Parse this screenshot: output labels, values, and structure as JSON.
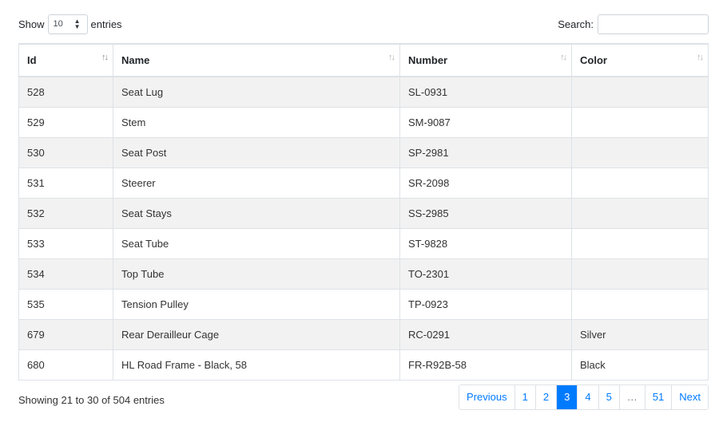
{
  "length_control": {
    "prefix": "Show",
    "selected": "10",
    "suffix": "entries"
  },
  "search": {
    "label": "Search:",
    "value": "",
    "placeholder": ""
  },
  "table": {
    "columns": [
      {
        "label": "Id",
        "sorted": "asc"
      },
      {
        "label": "Name",
        "sorted": "none"
      },
      {
        "label": "Number",
        "sorted": "none"
      },
      {
        "label": "Color",
        "sorted": "none"
      }
    ],
    "rows": [
      {
        "id": "528",
        "name": "Seat Lug",
        "number": "SL-0931",
        "color": ""
      },
      {
        "id": "529",
        "name": "Stem",
        "number": "SM-9087",
        "color": ""
      },
      {
        "id": "530",
        "name": "Seat Post",
        "number": "SP-2981",
        "color": ""
      },
      {
        "id": "531",
        "name": "Steerer",
        "number": "SR-2098",
        "color": ""
      },
      {
        "id": "532",
        "name": "Seat Stays",
        "number": "SS-2985",
        "color": ""
      },
      {
        "id": "533",
        "name": "Seat Tube",
        "number": "ST-9828",
        "color": ""
      },
      {
        "id": "534",
        "name": "Top Tube",
        "number": "TO-2301",
        "color": ""
      },
      {
        "id": "535",
        "name": "Tension Pulley",
        "number": "TP-0923",
        "color": ""
      },
      {
        "id": "679",
        "name": "Rear Derailleur Cage",
        "number": "RC-0291",
        "color": "Silver"
      },
      {
        "id": "680",
        "name": "HL Road Frame - Black, 58",
        "number": "FR-R92B-58",
        "color": "Black"
      }
    ]
  },
  "info": "Showing 21 to 30 of 504 entries",
  "pagination": {
    "previous": "Previous",
    "pages": [
      "1",
      "2",
      "3",
      "4",
      "5",
      "…",
      "51"
    ],
    "current": "3",
    "next": "Next"
  },
  "icons": {
    "sort": "↑↓",
    "select_caret": "▲▼"
  },
  "colors": {
    "accent": "#007bff",
    "stripe": "#f2f2f2",
    "border": "#dee2e6"
  }
}
